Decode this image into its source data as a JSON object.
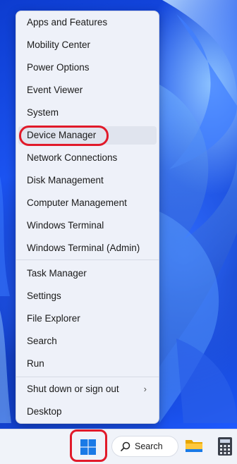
{
  "menu": {
    "group1": [
      {
        "label": "Apps and Features"
      },
      {
        "label": "Mobility Center"
      },
      {
        "label": "Power Options"
      },
      {
        "label": "Event Viewer"
      },
      {
        "label": "System"
      },
      {
        "label": "Device Manager"
      },
      {
        "label": "Network Connections"
      },
      {
        "label": "Disk Management"
      },
      {
        "label": "Computer Management"
      },
      {
        "label": "Windows Terminal"
      },
      {
        "label": "Windows Terminal (Admin)"
      }
    ],
    "group2": [
      {
        "label": "Task Manager"
      },
      {
        "label": "Settings"
      },
      {
        "label": "File Explorer"
      },
      {
        "label": "Search"
      },
      {
        "label": "Run"
      }
    ],
    "group3": [
      {
        "label": "Shut down or sign out",
        "submenu_icon": "chevron-right-icon"
      },
      {
        "label": "Desktop"
      }
    ],
    "highlighted_item": "Device Manager"
  },
  "taskbar": {
    "start_icon": "windows-logo-icon",
    "search_icon": "search-icon",
    "search_label": "Search",
    "pinned_icons": [
      "file-explorer-icon",
      "calculator-icon"
    ]
  },
  "colors": {
    "annotation": "#e11a2a",
    "windows_logo": "#1a7ae6"
  }
}
